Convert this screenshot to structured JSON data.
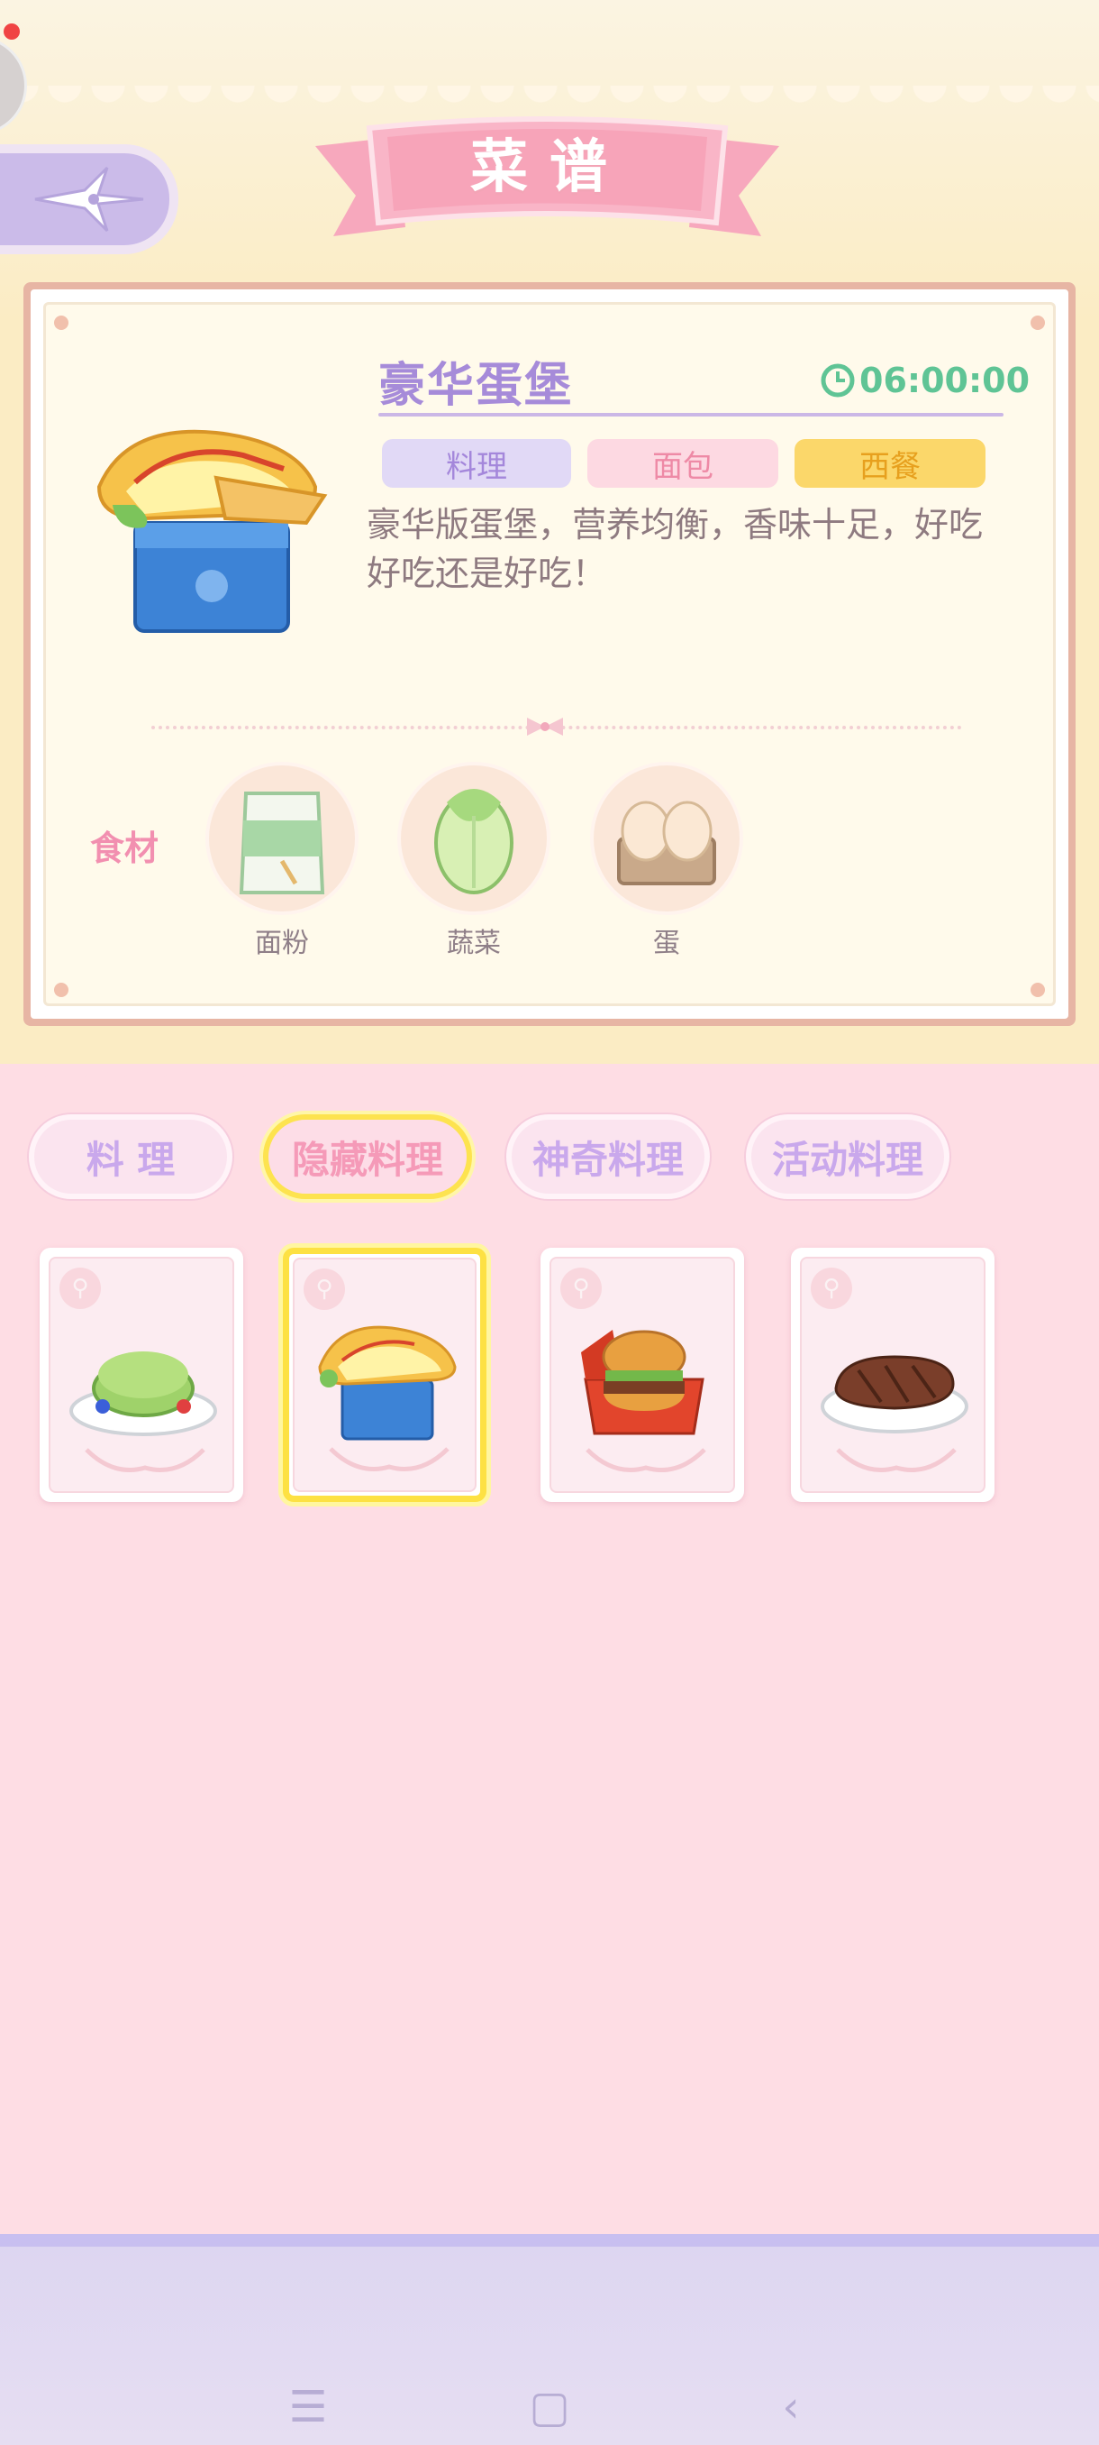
{
  "header": {
    "title": "菜谱"
  },
  "recipe": {
    "name": "豪华蛋堡",
    "timer": "06:00:00",
    "tags": [
      "料理",
      "面包",
      "西餐"
    ],
    "description": "豪华版蛋堡，营养均衡，香味十足，好吃好吃还是好吃！",
    "image_icon": "egg-burger-icon"
  },
  "ingredients": {
    "label": "食材",
    "items": [
      {
        "name": "面粉",
        "icon": "flour-bag-icon"
      },
      {
        "name": "蔬菜",
        "icon": "cabbage-icon"
      },
      {
        "name": "蛋",
        "icon": "eggs-icon"
      }
    ]
  },
  "tabs": [
    {
      "label": "料 理",
      "active": false
    },
    {
      "label": "隐藏料理",
      "active": true
    },
    {
      "label": "神奇料理",
      "active": false
    },
    {
      "label": "活动料理",
      "active": false
    }
  ],
  "recipe_cards": [
    {
      "icon": "kiwi-pancake-icon",
      "selected": false
    },
    {
      "icon": "egg-burger-icon",
      "selected": true
    },
    {
      "icon": "hamburger-box-icon",
      "selected": false
    },
    {
      "icon": "steak-icon",
      "selected": false
    }
  ],
  "colors": {
    "title_purple": "#a68bd9",
    "timer_green": "#5fc495",
    "accent_pink": "#f28fb0",
    "highlight_yellow": "#fde143"
  },
  "navbar": {
    "icons": [
      "menu-icon",
      "home-icon",
      "back-icon"
    ]
  }
}
